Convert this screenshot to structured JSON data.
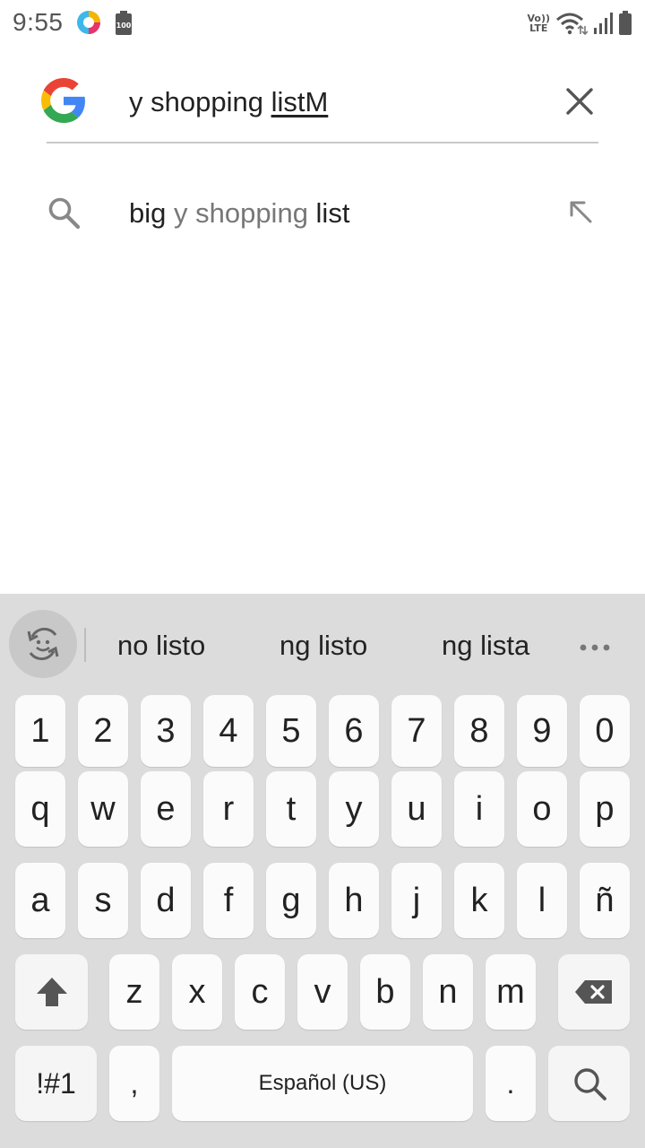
{
  "status_bar": {
    "time": "9:55",
    "volte_top": "Vo))",
    "volte_bottom": "LTE",
    "battery_small_label": "100"
  },
  "search": {
    "query_committed": "y shopping ",
    "query_composing": "listM"
  },
  "suggestions": [
    {
      "bold_prefix": "big ",
      "dim_part": "y shopping ",
      "bold_suffix": "list"
    }
  ],
  "keyboard": {
    "word_suggestions": [
      "no listo",
      "ng listo",
      "ng lista"
    ],
    "number_row": [
      "1",
      "2",
      "3",
      "4",
      "5",
      "6",
      "7",
      "8",
      "9",
      "0"
    ],
    "row1": [
      "q",
      "w",
      "e",
      "r",
      "t",
      "y",
      "u",
      "i",
      "o",
      "p"
    ],
    "row2": [
      "a",
      "s",
      "d",
      "f",
      "g",
      "h",
      "j",
      "k",
      "l",
      "ñ"
    ],
    "row3": [
      "z",
      "x",
      "c",
      "v",
      "b",
      "n",
      "m"
    ],
    "symbols_label": "!#1",
    "comma_label": ",",
    "space_label": "Español (US)",
    "period_label": "."
  },
  "colors": {
    "keyboard_bg": "#dcdcdc",
    "key_bg": "#fbfbfb",
    "google_blue": "#4285F4",
    "google_red": "#EA4335",
    "google_yellow": "#FBBC05",
    "google_green": "#34A853"
  }
}
